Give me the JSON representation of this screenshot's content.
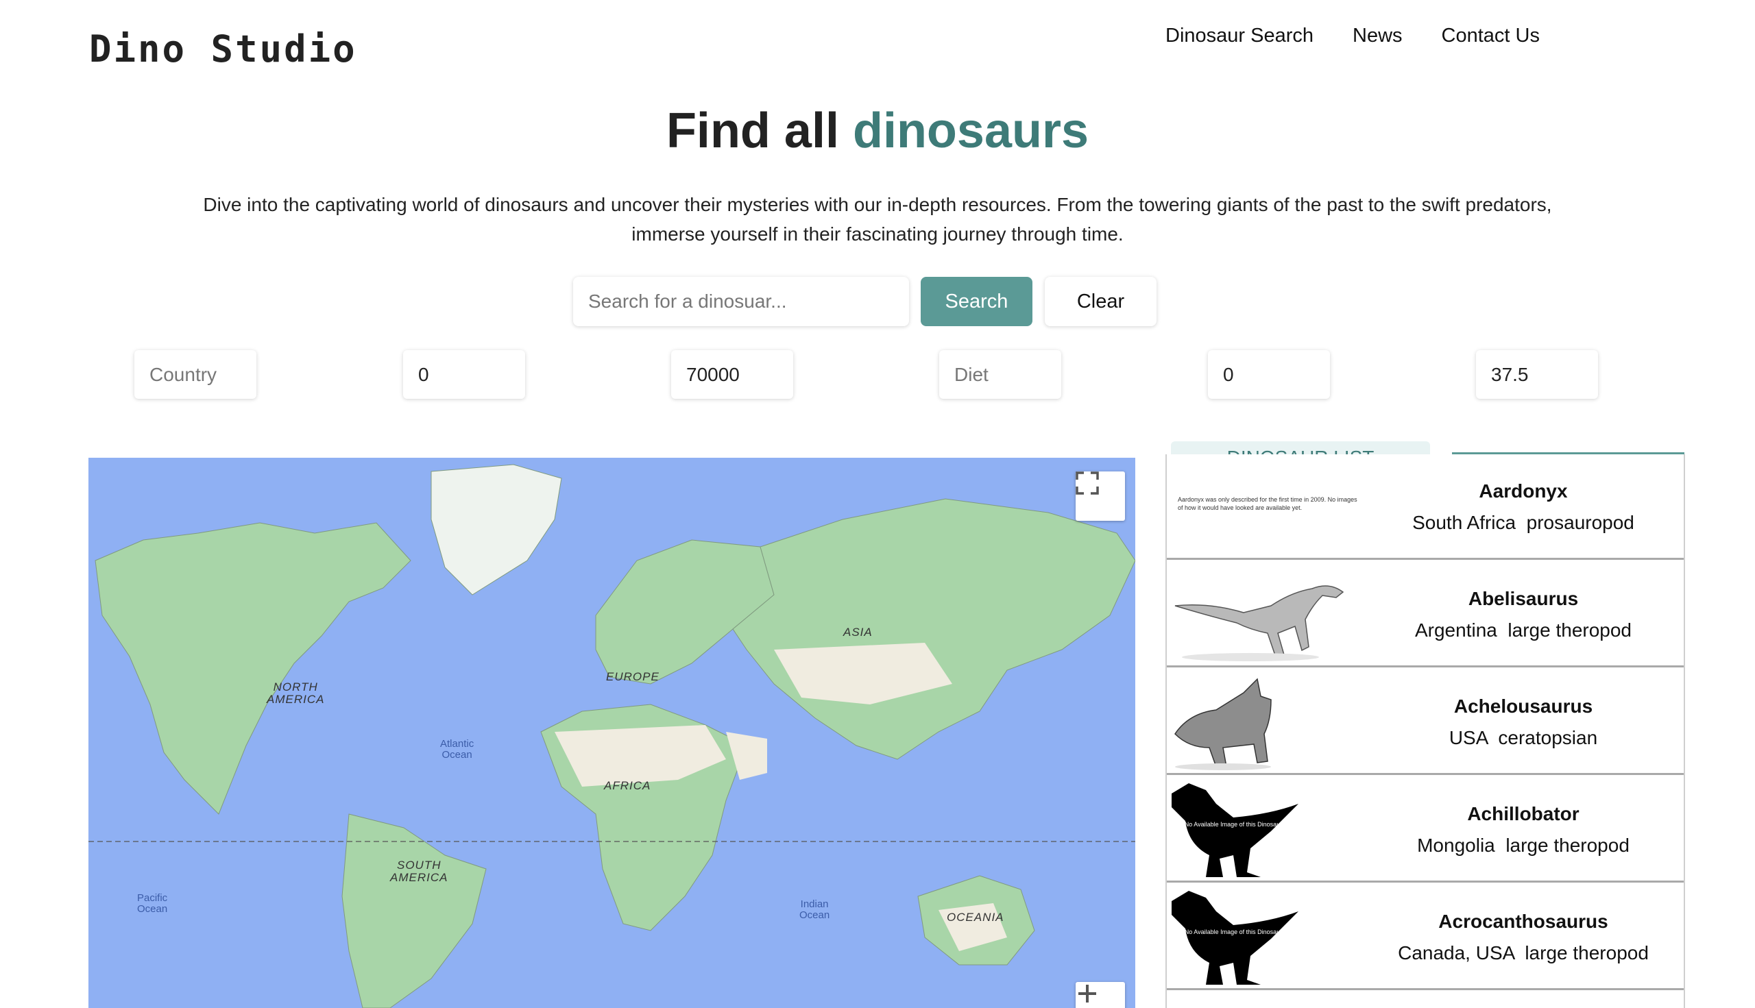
{
  "header": {
    "logo": "Dino Studio",
    "nav": [
      "Dinosaur Search",
      "News",
      "Contact Us"
    ]
  },
  "hero": {
    "title_plain": "Find all",
    "title_accent": "dinosaurs",
    "subtitle": "Dive into the captivating world of dinosaurs and uncover their mysteries with our in-depth resources. From the towering giants of the past to the swift predators, immerse yourself in their fascinating journey through time."
  },
  "search": {
    "placeholder": "Search for a dinosuar...",
    "search_label": "Search",
    "clear_label": "Clear"
  },
  "filters": {
    "country_placeholder": "Country",
    "min_value": "0",
    "max_value": "70000",
    "diet_placeholder": "Diet",
    "length_min_value": "0",
    "length_max_value": "37.5"
  },
  "map": {
    "continents": [
      "NORTH\nAMERICA",
      "SOUTH\nAMERICA",
      "EUROPE",
      "AFRICA",
      "ASIA",
      "OCEANIA"
    ],
    "oceans": [
      "Atlantic\nOcean",
      "Pacific\nOcean",
      "Indian\nOcean"
    ],
    "colors": {
      "water": "#8fb0f3",
      "land": "#a8d5a8",
      "desert": "#f0ece0"
    }
  },
  "dinosaur_list": {
    "tab_label": "DINOSAUR LIST",
    "items": [
      {
        "name": "Aardonyx",
        "country": "South Africa",
        "diet": "prosauropod",
        "note": "Aardonyx was only described for the first time in 2009.\nNo images of how it would have looked are available yet."
      },
      {
        "name": "Abelisaurus",
        "country": "Argentina",
        "diet": "large theropod"
      },
      {
        "name": "Achelousaurus",
        "country": "USA",
        "diet": "ceratopsian"
      },
      {
        "name": "Achillobator",
        "country": "Mongolia",
        "diet": "large theropod",
        "placeholder_text": "No Available Image of this Dinosaur"
      },
      {
        "name": "Acrocanthosaurus",
        "country": "Canada, USA",
        "diet": "large theropod",
        "placeholder_text": "No Available Image of this Dinosaur"
      }
    ]
  }
}
